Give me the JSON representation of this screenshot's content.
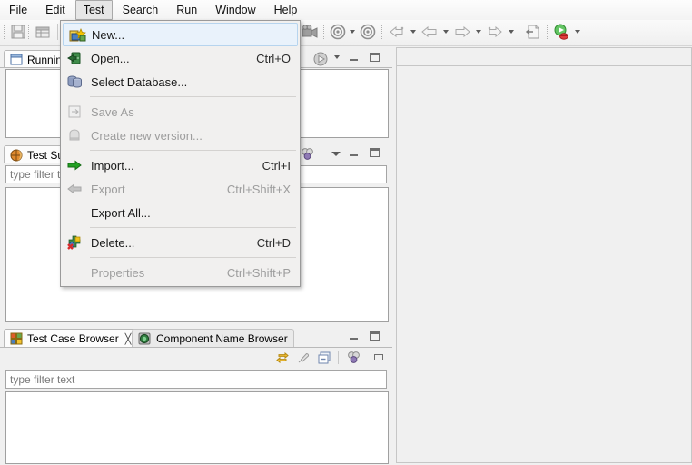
{
  "app": {
    "accent": "#e9f2fb",
    "menu_bg": "#f1f0ef",
    "panel_bg": "#f0f0f0"
  },
  "menubar": {
    "items": [
      {
        "label": "File",
        "active": false
      },
      {
        "label": "Edit",
        "active": false
      },
      {
        "label": "Test",
        "active": true
      },
      {
        "label": "Search",
        "active": false
      },
      {
        "label": "Run",
        "active": false
      },
      {
        "label": "Window",
        "active": false
      },
      {
        "label": "Help",
        "active": false
      }
    ]
  },
  "toolbar": {
    "items": [
      {
        "name": "save-icon",
        "tooltip": "Save"
      },
      {
        "name": "table-icon",
        "tooltip": "Properties"
      },
      {
        "name": "record-icon",
        "tooltip": "Record"
      },
      {
        "name": "camera-icon",
        "tooltip": "Observation Mode"
      },
      {
        "name": "target-icon",
        "tooltip": "Start Object Mapping"
      },
      {
        "name": "target2-icon",
        "tooltip": "Stop Object Mapping"
      },
      {
        "name": "step-back-icon",
        "tooltip": "Step Back"
      },
      {
        "name": "back-icon",
        "tooltip": "Back"
      },
      {
        "name": "forward-icon",
        "tooltip": "Forward"
      },
      {
        "name": "step-forward-icon",
        "tooltip": "Step Forward"
      },
      {
        "name": "export-page-icon",
        "tooltip": "Export"
      },
      {
        "name": "run-test-icon",
        "tooltip": "Run Test"
      }
    ]
  },
  "dropdown": {
    "title": "Test",
    "items": [
      {
        "label": "New...",
        "shortcut": "",
        "icon": "new-icon",
        "disabled": false,
        "selected": true,
        "separator_after": false
      },
      {
        "label": "Open...",
        "shortcut": "Ctrl+O",
        "icon": "open-icon",
        "disabled": false,
        "selected": false,
        "separator_after": false
      },
      {
        "label": "Select Database...",
        "shortcut": "",
        "icon": "database-icon",
        "disabled": false,
        "selected": false,
        "separator_after": true
      },
      {
        "label": "Save As",
        "shortcut": "",
        "icon": "save-as-icon",
        "disabled": true,
        "selected": false,
        "separator_after": false
      },
      {
        "label": "Create new version...",
        "shortcut": "",
        "icon": "version-icon",
        "disabled": true,
        "selected": false,
        "separator_after": true
      },
      {
        "label": "Import...",
        "shortcut": "Ctrl+I",
        "icon": "import-arrow-icon",
        "disabled": false,
        "selected": false,
        "separator_after": false
      },
      {
        "label": "Export",
        "shortcut": "Ctrl+Shift+X",
        "icon": "export-arrow-icon",
        "disabled": true,
        "selected": false,
        "separator_after": false
      },
      {
        "label": "Export All...",
        "shortcut": "",
        "icon": "",
        "disabled": false,
        "selected": false,
        "separator_after": true
      },
      {
        "label": "Delete...",
        "shortcut": "Ctrl+D",
        "icon": "delete-icon",
        "disabled": false,
        "selected": false,
        "separator_after": true
      },
      {
        "label": "Properties",
        "shortcut": "Ctrl+Shift+P",
        "icon": "",
        "disabled": true,
        "selected": false,
        "separator_after": false
      }
    ]
  },
  "views": {
    "running": {
      "tab_label": "Running",
      "icon": "window-icon"
    },
    "test_suite_browser": {
      "tab_label": "Test Suite",
      "icon": "test-suite-icon",
      "filter_placeholder": "type filter text"
    },
    "test_case_browser": {
      "tab_label": "Test Case Browser",
      "icon": "test-case-icon",
      "close_glyph": "╳",
      "filter_placeholder": "type filter text"
    },
    "component_name_browser": {
      "tab_label": "Component Name Browser",
      "icon": "component-name-icon"
    },
    "view_toolbar": {
      "items": [
        {
          "name": "link-with-editor-icon"
        },
        {
          "name": "pin-icon"
        },
        {
          "name": "collapse-all-icon"
        },
        {
          "name": "filter-profiles-icon"
        },
        {
          "name": "view-menu-icon"
        }
      ]
    },
    "chevrons": {
      "view_menu": "view-menu-chevron",
      "minimize": "minimize-glyph",
      "maximize": "maximize-glyph"
    }
  }
}
